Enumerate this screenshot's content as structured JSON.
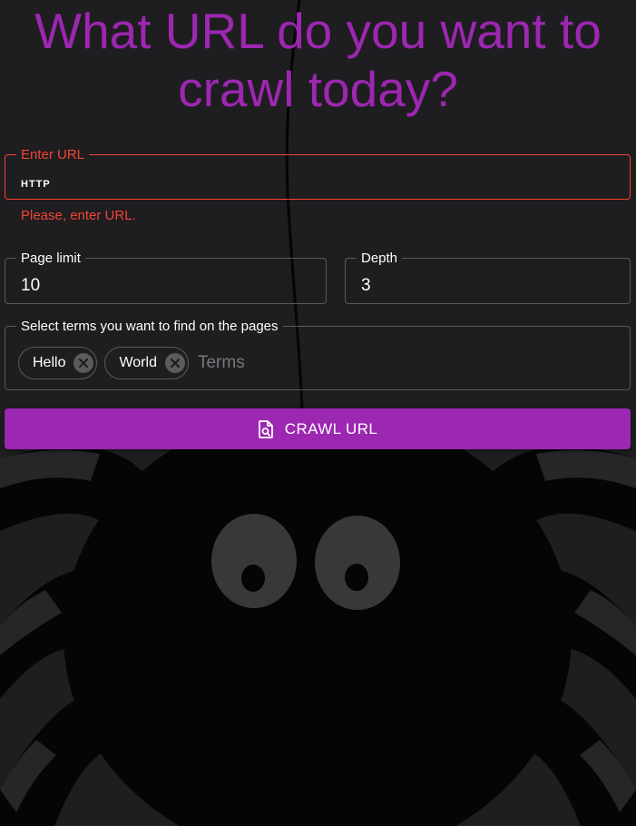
{
  "headline": "What URL do you want to crawl today?",
  "url_field": {
    "label": "Enter URL",
    "value": "HTTP",
    "error": "Please, enter URL."
  },
  "page_limit_field": {
    "label": "Page limit",
    "value": "10"
  },
  "depth_field": {
    "label": "Depth",
    "value": "3"
  },
  "terms_field": {
    "label": "Select terms you want to find on the pages",
    "chips": [
      {
        "label": "Hello"
      },
      {
        "label": "World"
      }
    ],
    "placeholder": "Terms"
  },
  "crawl_button": {
    "label": "CRAWL URL",
    "icon": "file-search-icon"
  },
  "colors": {
    "accent": "#9c27b0",
    "error": "#f44336",
    "background": "#1e1d1f",
    "spider": "#050505"
  }
}
